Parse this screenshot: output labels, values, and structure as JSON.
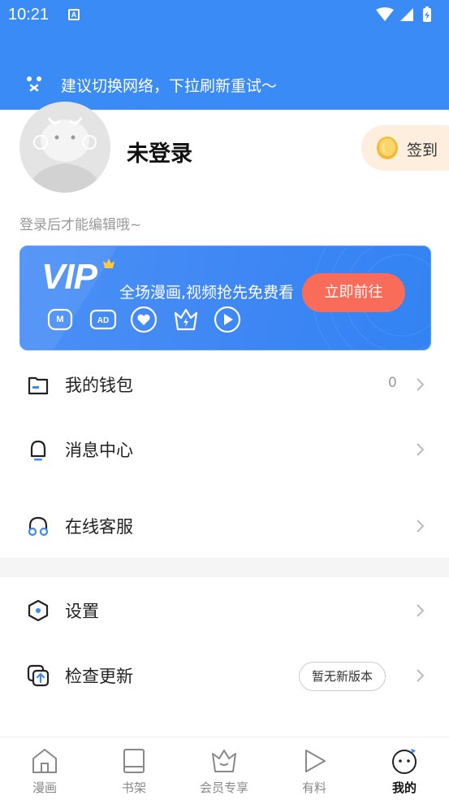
{
  "status_bar": {
    "time": "10:21",
    "notif_letter": "A"
  },
  "banner": {
    "network_hint": "建议切换网络，下拉刷新重试～"
  },
  "profile": {
    "username": "未登录",
    "checkin_label": "签到",
    "login_hint": "登录后才能编辑哦~"
  },
  "vip": {
    "logo": "VIP",
    "slogan": "全场漫画,视频抢先免费看",
    "go_label": "立即前往",
    "perks": [
      "manga-perk-icon",
      "ad-free-perk-icon",
      "heart-perk-icon",
      "crown-perk-icon",
      "video-perk-icon"
    ]
  },
  "menu": {
    "wallet": {
      "label": "我的钱包",
      "count": "0"
    },
    "messages": {
      "label": "消息中心"
    },
    "support": {
      "label": "在线客服"
    },
    "settings": {
      "label": "设置"
    },
    "update": {
      "label": "检查更新",
      "badge": "暂无新版本"
    }
  },
  "bottom_nav": {
    "items": [
      {
        "label": "漫画",
        "icon": "home-icon"
      },
      {
        "label": "书架",
        "icon": "book-icon"
      },
      {
        "label": "会员专享",
        "icon": "crown-icon"
      },
      {
        "label": "有料",
        "icon": "play-icon"
      },
      {
        "label": "我的",
        "icon": "face-icon",
        "active": true
      }
    ]
  },
  "colors": {
    "primary": "#3a8bf5",
    "vip_button": "#f86c59",
    "checkin_bg": "#fdeedd",
    "coin": "#f7c948"
  }
}
